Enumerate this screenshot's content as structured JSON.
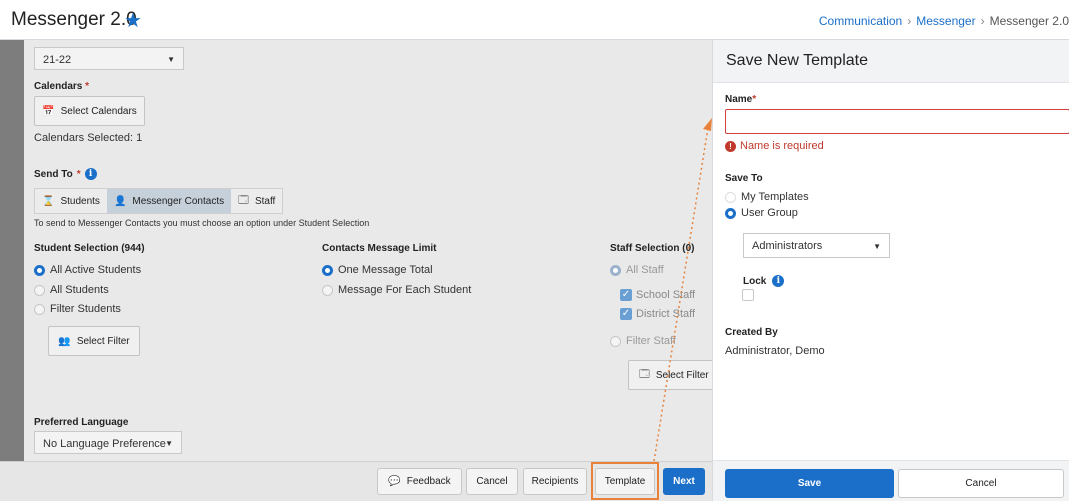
{
  "header": {
    "title": "Messenger 2.0",
    "breadcrumb": [
      "Communication",
      "Messenger",
      "Messenger 2.0"
    ]
  },
  "form": {
    "school_year": "21-22",
    "calendars_label": "Calendars",
    "select_calendars": "Select Calendars",
    "calendars_selected": "Calendars Selected: 1",
    "send_to_label": "Send To",
    "send_to_options": [
      "Students",
      "Messenger Contacts",
      "Staff"
    ],
    "send_to_hint": "To send to Messenger Contacts you must choose an option under Student Selection",
    "student_selection": {
      "header": "Student Selection (944)",
      "options": [
        "All Active Students",
        "All Students",
        "Filter Students"
      ],
      "select_filter": "Select Filter"
    },
    "contacts_limit": {
      "header": "Contacts Message Limit",
      "options": [
        "One Message Total",
        "Message For Each Student"
      ]
    },
    "staff_selection": {
      "header": "Staff Selection (0)",
      "all_staff": "All Staff",
      "school_staff": "School Staff",
      "district_staff": "District Staff",
      "filter_staff": "Filter Staff",
      "select_filter": "Select Filter"
    },
    "preferred_language_label": "Preferred Language",
    "preferred_language_value": "No Language Preference"
  },
  "bottom_bar": {
    "feedback": "Feedback",
    "cancel": "Cancel",
    "recipients": "Recipients",
    "template": "Template",
    "next": "Next"
  },
  "panel": {
    "title": "Save New Template",
    "name_label": "Name",
    "name_value": "",
    "name_error": "Name is required",
    "save_to_label": "Save To",
    "save_to_options": [
      "My Templates",
      "User Group"
    ],
    "user_group_value": "Administrators",
    "lock_label": "Lock",
    "created_by_label": "Created By",
    "created_by_value": "Administrator, Demo",
    "save": "Save",
    "cancel": "Cancel"
  },
  "colors": {
    "accent": "#1b6fc9",
    "error": "#c0392b",
    "highlight": "#e8823a"
  }
}
